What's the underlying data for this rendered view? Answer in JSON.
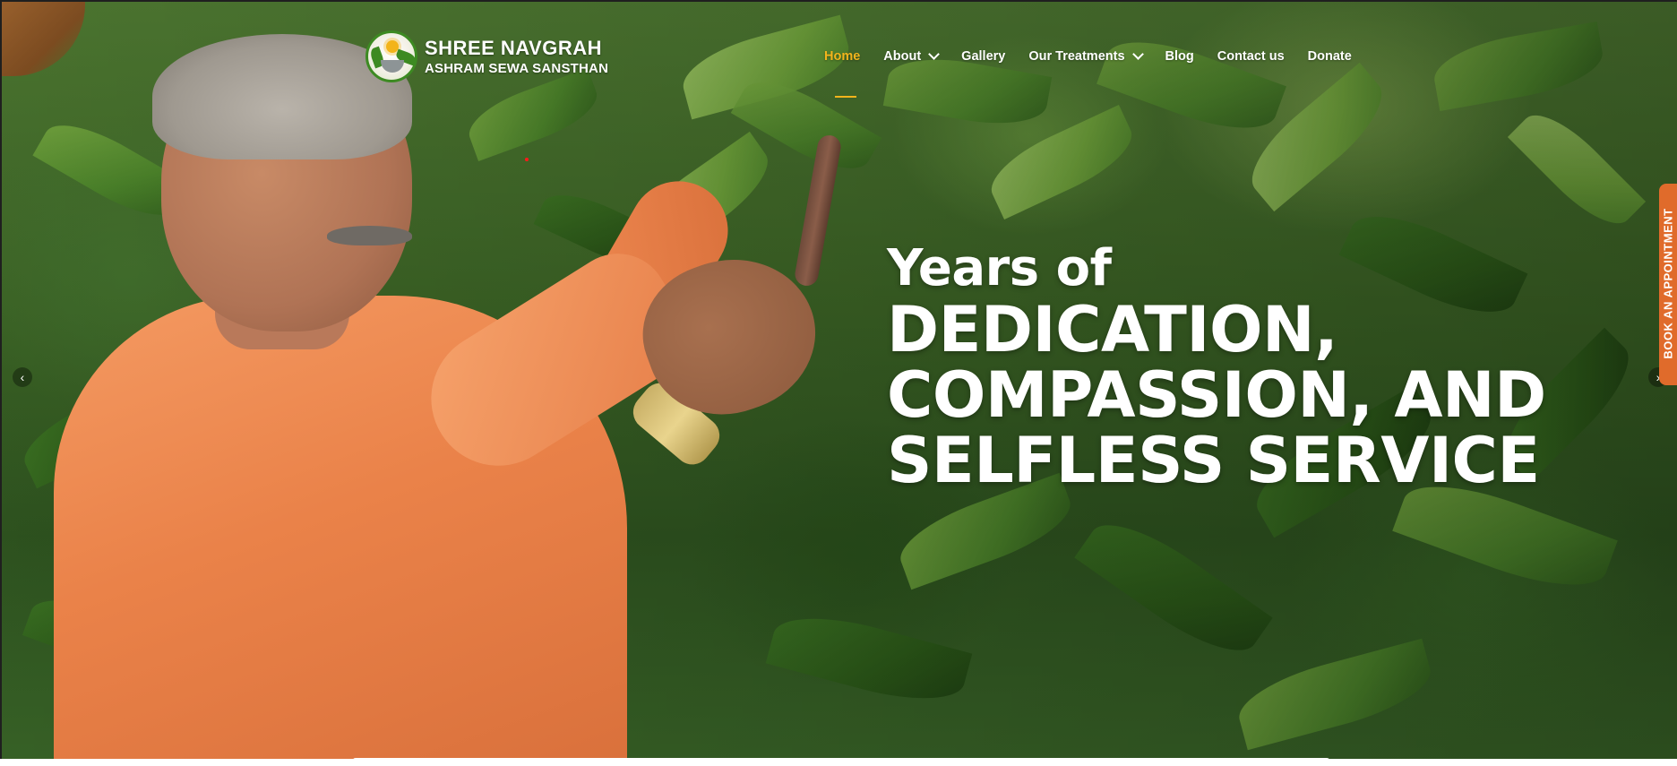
{
  "brand": {
    "name_line1": "SHREE NAVGRAH",
    "name_line2": "ASHRAM SEWA SANSTHAN"
  },
  "nav": {
    "items": [
      {
        "label": "Home",
        "active": true,
        "has_dropdown": false
      },
      {
        "label": "About",
        "active": false,
        "has_dropdown": true
      },
      {
        "label": "Gallery",
        "active": false,
        "has_dropdown": false
      },
      {
        "label": "Our Treatments",
        "active": false,
        "has_dropdown": true
      },
      {
        "label": "Blog",
        "active": false,
        "has_dropdown": false
      },
      {
        "label": "Contact us",
        "active": false,
        "has_dropdown": false
      },
      {
        "label": "Donate",
        "active": false,
        "has_dropdown": false
      }
    ]
  },
  "hero": {
    "heading_small": "Years of",
    "heading_line1": "DEDICATION,",
    "heading_line2": "COMPASSION, AND",
    "heading_line3": "SELFLESS SERVICE"
  },
  "side_tab": {
    "label": "BOOK AN APPOINTMENT"
  },
  "slider": {
    "prev_icon": "chevron-left-icon",
    "next_icon": "chevron-right-icon",
    "prev_glyph": "‹",
    "next_glyph": "›"
  },
  "colors": {
    "accent": "#f2b41c",
    "side_tab": "#e06b2b",
    "logo_green": "#3d8a22",
    "text": "#ffffff"
  }
}
